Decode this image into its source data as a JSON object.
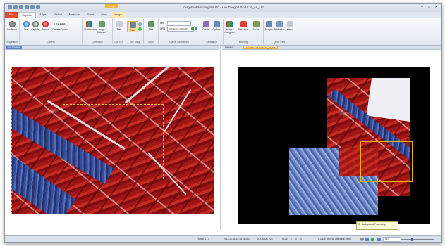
{
  "window": {
    "title": "ImageProPlus Insight 8.0.0 - Live Tiling 11-04-14 16_49_18*",
    "context_tab": "Image",
    "controls": {
      "minimize": "–",
      "maximize": "□",
      "close": "✕"
    }
  },
  "tabs": [
    "File",
    "Capture",
    "Adjust",
    "Select",
    "Measure",
    "Share",
    "View",
    "Image"
  ],
  "ribbon": {
    "acquisition": {
      "label": "Acquisition",
      "configure": "Configure"
    },
    "camera": {
      "label": "Camera",
      "live": "Live",
      "capture": "Capture",
      "record": "Record",
      "fps": "6.74 FPS",
      "camera_control": "Camera Control"
    },
    "composite": {
      "label": "Composite",
      "grid": "Grid",
      "fluorescence": "Fluorescence",
      "image_colorizer": "Image Colorizer"
    },
    "live_edf": {
      "label": "Live EDF",
      "start": "Start"
    },
    "live_tiling": {
      "label": "Live Tiling",
      "start": "Start",
      "stop": "Stop"
    },
    "mdm": {
      "label": "MDM",
      "start": "Start"
    },
    "optical": {
      "label": "Optical Calibrations",
      "units": "mm",
      "objective": "UPlanApo 10x/0.40",
      "item2": "ORG"
    },
    "calibration": {
      "label": "Calibration",
      "create": "Create",
      "options": "Options"
    },
    "metering": {
      "label": "Metering",
      "image_histogram": "Image Histogram",
      "saturation": "Saturation",
      "focus": "Focus"
    },
    "quick_view": {
      "label": "Quick View",
      "analyze": "Analyze",
      "publication": "Publication",
      "menu": "Menu"
    }
  },
  "left_pane": {
    "tab": "Live Preview"
  },
  "right_pane": {
    "tabs": [
      "Welcome",
      "Live Tiling 11-04-14 16_49_18*"
    ]
  },
  "tooltip": {
    "text": "Background Processing"
  },
  "status": {
    "frame": "Frame: 1 / 1",
    "timestamp": "2013-11-04 14:16:14:001",
    "xy": "X,Y: 5936, 226",
    "rgb": "RGB:",
    "r": "0",
    "g": "0",
    "b": "0",
    "calibration": "0.Calib: mm (5x Objective Lens)",
    "zoom": "12%"
  }
}
